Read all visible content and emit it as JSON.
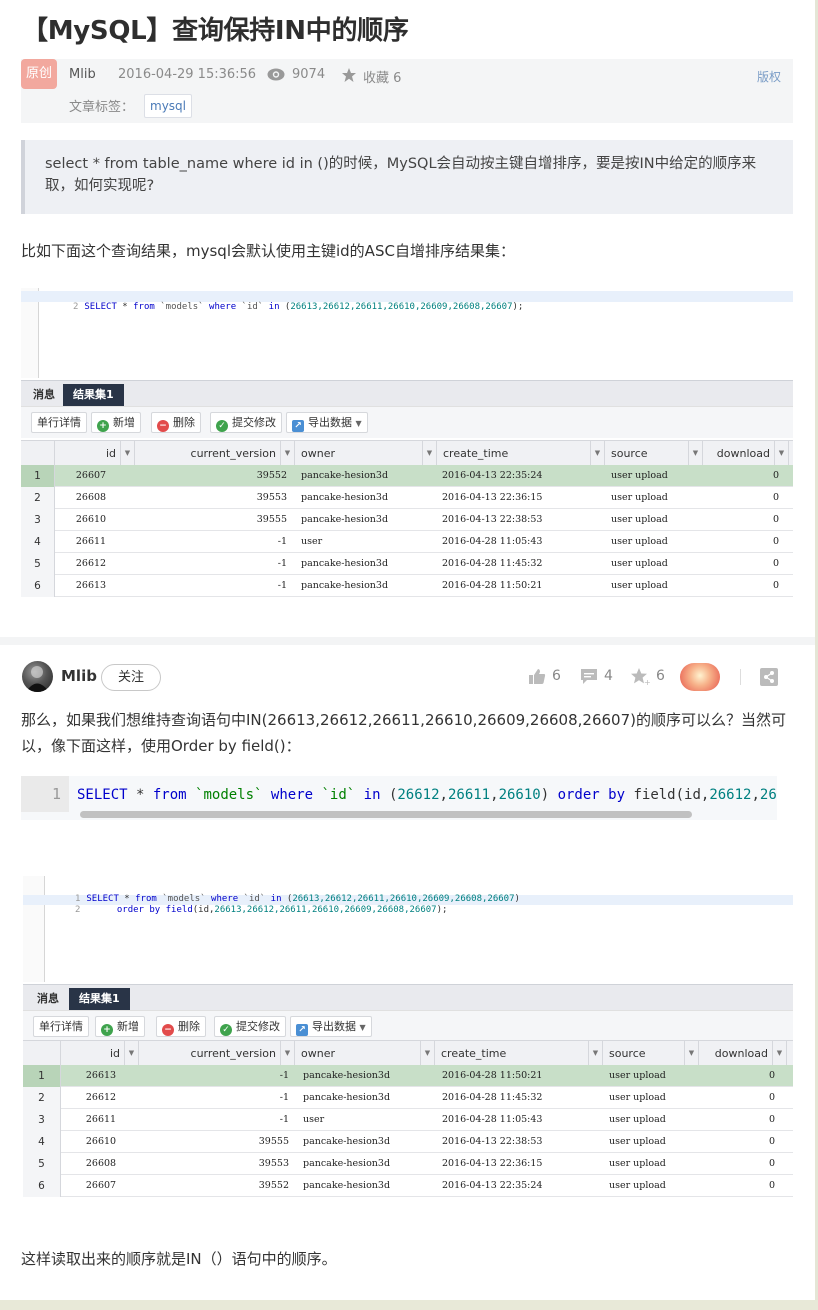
{
  "title": "【MySQL】查询保持IN中的顺序",
  "meta": {
    "badge": "原创",
    "author": "Mlib",
    "date": "2016-04-29 15:36:56",
    "views": "9074",
    "favorites": "收藏 6",
    "copyright": "版权",
    "tags_label": "文章标签：",
    "tag": "mysql"
  },
  "quote": "select * from table_name where id in ()的时候，MySQL会自动按主键自增排序，要是按IN中给定的顺序来取，如何实现呢?",
  "para1": "比如下面这个查询结果，mysql会默认使用主键id的ASC自增排序结果集：",
  "shot1": {
    "sql_lines": [
      {
        "num": "2",
        "text": "SELECT * from `models` where `id` in (26613,26612,26611,26610,26609,26608,26607);"
      }
    ],
    "tabs": [
      "消息",
      "结果集1"
    ],
    "toolbar": [
      "单行详情",
      "新增",
      "删除",
      "提交修改",
      "导出数据"
    ],
    "columns": [
      "id",
      "current_version",
      "owner",
      "create_time",
      "source",
      "download"
    ],
    "rows": [
      [
        "1",
        "26607",
        "39552",
        "pancake-hesion3d",
        "2016-04-13 22:35:24",
        "user upload",
        "0"
      ],
      [
        "2",
        "26608",
        "39553",
        "pancake-hesion3d",
        "2016-04-13 22:36:15",
        "user upload",
        "0"
      ],
      [
        "3",
        "26610",
        "39555",
        "pancake-hesion3d",
        "2016-04-13 22:38:53",
        "user upload",
        "0"
      ],
      [
        "4",
        "26611",
        "-1",
        "user",
        "2016-04-28 11:05:43",
        "user upload",
        "0"
      ],
      [
        "5",
        "26612",
        "-1",
        "pancake-hesion3d",
        "2016-04-28 11:45:32",
        "user upload",
        "0"
      ],
      [
        "6",
        "26613",
        "-1",
        "pancake-hesion3d",
        "2016-04-28 11:50:21",
        "user upload",
        "0"
      ]
    ]
  },
  "author_bar": {
    "name": "Mlib",
    "follow": "关注",
    "likes": "6",
    "comments": "4",
    "stars": "6"
  },
  "para2": "那么，如果我们想维持查询语句中IN(26613,26612,26611,26610,26609,26608,26607)的顺序可以么？当然可以，像下面这样，使用Order by field()：",
  "code": {
    "line": "1",
    "text": "SELECT * from `models` where `id` in (26612,26611,26610) order by field(id,26612,26"
  },
  "shot2": {
    "sql_lines": [
      {
        "num": "1",
        "text": "SELECT * from `models` where `id` in (26613,26612,26611,26610,26609,26608,26607)"
      },
      {
        "num": "2",
        "text": "    order by field(id,26613,26612,26611,26610,26609,26608,26607);"
      }
    ],
    "tabs": [
      "消息",
      "结果集1"
    ],
    "toolbar": [
      "单行详情",
      "新增",
      "删除",
      "提交修改",
      "导出数据"
    ],
    "columns": [
      "id",
      "current_version",
      "owner",
      "create_time",
      "source",
      "download"
    ],
    "rows": [
      [
        "1",
        "26613",
        "-1",
        "pancake-hesion3d",
        "2016-04-28 11:50:21",
        "user upload",
        "0"
      ],
      [
        "2",
        "26612",
        "-1",
        "pancake-hesion3d",
        "2016-04-28 11:45:32",
        "user upload",
        "0"
      ],
      [
        "3",
        "26611",
        "-1",
        "user",
        "2016-04-28 11:05:43",
        "user upload",
        "0"
      ],
      [
        "4",
        "26610",
        "39555",
        "pancake-hesion3d",
        "2016-04-13 22:38:53",
        "user upload",
        "0"
      ],
      [
        "5",
        "26608",
        "39553",
        "pancake-hesion3d",
        "2016-04-13 22:36:15",
        "user upload",
        "0"
      ],
      [
        "6",
        "26607",
        "39552",
        "pancake-hesion3d",
        "2016-04-13 22:35:24",
        "user upload",
        "0"
      ]
    ]
  },
  "para3": "这样读取出来的顺序就是IN（）语句中的顺序。"
}
